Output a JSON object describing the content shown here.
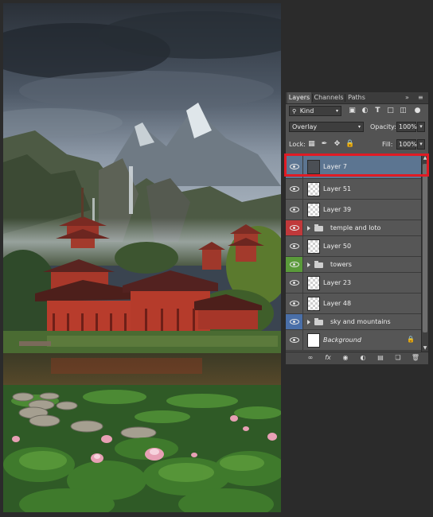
{
  "panel": {
    "tabs": [
      {
        "label": "Layers",
        "active": true
      },
      {
        "label": "Channels",
        "active": false
      },
      {
        "label": "Paths",
        "active": false
      }
    ],
    "collapse_glyph": "»",
    "menu_glyph": "≡",
    "filter": {
      "label": "Kind",
      "icon": "search-icon"
    },
    "blend_mode": "Overlay",
    "opacity_label": "Opacity:",
    "opacity_value": "100%",
    "lock_label": "Lock:",
    "fill_label": "Fill:",
    "fill_value": "100%"
  },
  "layers": [
    {
      "name": "Layer 7",
      "type": "layer",
      "visible": true,
      "selected": true,
      "thumb": "dark",
      "tag_color": null
    },
    {
      "name": "Layer 51",
      "type": "layer",
      "visible": true,
      "selected": false,
      "thumb": "transparent",
      "tag_color": null
    },
    {
      "name": "Layer 39",
      "type": "layer",
      "visible": true,
      "selected": false,
      "thumb": "transparent",
      "tag_color": null
    },
    {
      "name": "temple and loto",
      "type": "group",
      "visible": true,
      "selected": false,
      "tag_color": "#c0393b"
    },
    {
      "name": "Layer 50",
      "type": "layer",
      "visible": true,
      "selected": false,
      "thumb": "transparent",
      "tag_color": null
    },
    {
      "name": "towers",
      "type": "group",
      "visible": true,
      "selected": false,
      "tag_color": "#5a9a3a"
    },
    {
      "name": "Layer 23",
      "type": "layer",
      "visible": true,
      "selected": false,
      "thumb": "transparent",
      "tag_color": null
    },
    {
      "name": "Layer 48",
      "type": "layer",
      "visible": true,
      "selected": false,
      "thumb": "transparent",
      "tag_color": null
    },
    {
      "name": "sky and mountains",
      "type": "group",
      "visible": true,
      "selected": false,
      "tag_color": "#4a6fa8"
    },
    {
      "name": "Background",
      "type": "background",
      "visible": true,
      "selected": false,
      "thumb": "white",
      "tag_color": null
    }
  ],
  "bottom_bar": {
    "icons": [
      "link-icon",
      "fx-icon",
      "mask-icon",
      "adjustment-icon",
      "group-icon",
      "new-layer-icon",
      "trash-icon"
    ],
    "fx_label": "fx"
  },
  "colors": {
    "panel_bg": "#535353",
    "selected_row": "#5c7591",
    "highlight": "#e01b24"
  }
}
